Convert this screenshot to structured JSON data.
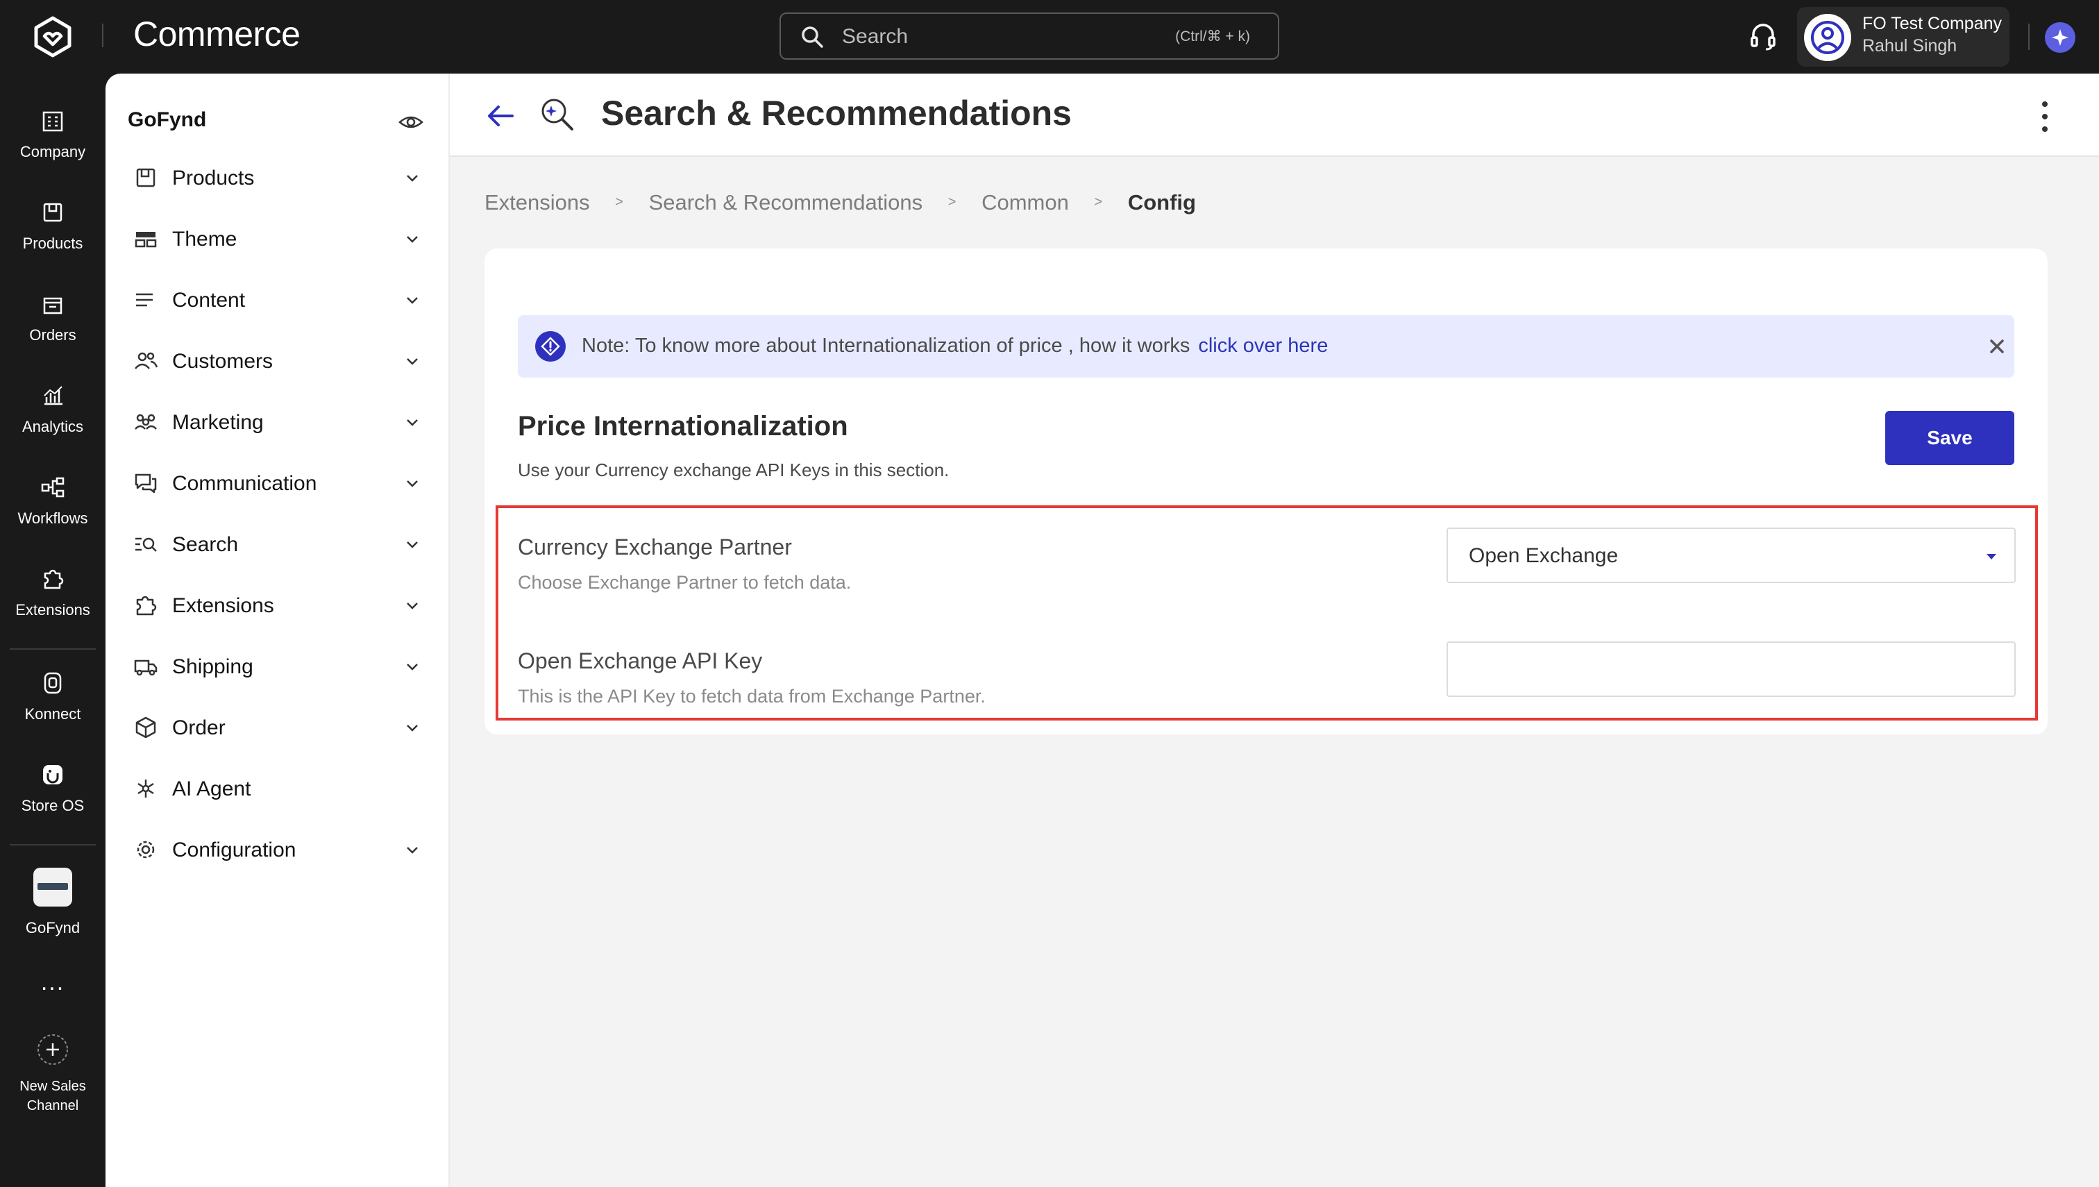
{
  "app": {
    "brand": "Commerce",
    "search_placeholder": "Search",
    "search_shortcut": "(Ctrl/⌘ + k)",
    "company_name": "FO Test Company",
    "user_name": "Rahul Singh"
  },
  "rail": {
    "items": [
      {
        "label": "Company",
        "icon": "building-icon"
      },
      {
        "label": "Products",
        "icon": "box-icon"
      },
      {
        "label": "Orders",
        "icon": "bag-icon"
      },
      {
        "label": "Analytics",
        "icon": "analytics-icon"
      },
      {
        "label": "Workflows",
        "icon": "workflow-icon"
      },
      {
        "label": "Extensions",
        "icon": "puzzle-icon"
      },
      {
        "label": "Konnect",
        "icon": "konnect-icon"
      },
      {
        "label": "Store OS",
        "icon": "store-os-icon"
      },
      {
        "label": "GoFynd",
        "icon": "gofynd-thumb"
      },
      {
        "label": "New Sales",
        "label2": "Channel",
        "icon": "plus-circle-icon"
      }
    ],
    "more": "..."
  },
  "nav": {
    "title": "GoFynd",
    "items": [
      {
        "label": "Products",
        "icon": "box-icon",
        "expandable": true
      },
      {
        "label": "Theme",
        "icon": "layout-icon",
        "expandable": true
      },
      {
        "label": "Content",
        "icon": "list-icon",
        "expandable": true
      },
      {
        "label": "Customers",
        "icon": "users-icon",
        "expandable": true
      },
      {
        "label": "Marketing",
        "icon": "megaphone-icon",
        "expandable": true
      },
      {
        "label": "Communication",
        "icon": "chat-icon",
        "expandable": true
      },
      {
        "label": "Search",
        "icon": "search-list-icon",
        "expandable": true
      },
      {
        "label": "Extensions",
        "icon": "puzzle-icon",
        "expandable": true
      },
      {
        "label": "Shipping",
        "icon": "truck-icon",
        "expandable": true
      },
      {
        "label": "Order",
        "icon": "cube-icon",
        "expandable": true
      },
      {
        "label": "AI Agent",
        "icon": "ai-agent-icon",
        "expandable": false
      },
      {
        "label": "Configuration",
        "icon": "gear-icon",
        "expandable": true
      }
    ]
  },
  "page": {
    "title": "Search & Recommendations",
    "breadcrumb": [
      "Extensions",
      "Search & Recommendations",
      "Common",
      "Config"
    ],
    "breadcrumb_separator": ">"
  },
  "note": {
    "text": "Note: To know more about Internationalization of price , how it works",
    "link": "click over here"
  },
  "section": {
    "title": "Price Internationalization",
    "subtitle": "Use your Currency exchange API Keys in this section.",
    "save_label": "Save"
  },
  "fields": {
    "partner_label": "Currency Exchange Partner",
    "partner_help": "Choose Exchange Partner to fetch data.",
    "partner_value": "Open Exchange",
    "api_key_label": "Open Exchange API Key",
    "api_key_help": "This is the API Key to fetch data from Exchange Partner.",
    "api_key_value": ""
  },
  "colors": {
    "accent": "#2e31be",
    "highlight_border": "#e53935",
    "note_bg": "#e8ebff",
    "dark_bg": "#1a1a1a"
  }
}
